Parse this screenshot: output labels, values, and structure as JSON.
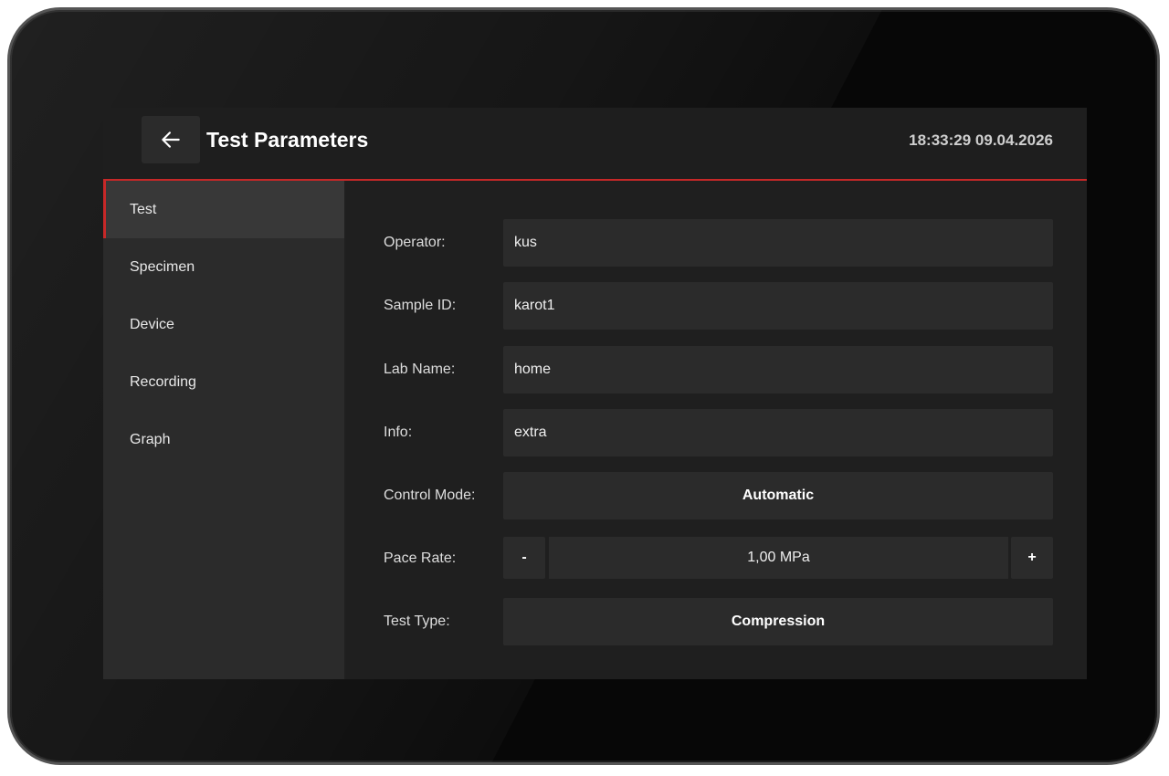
{
  "header": {
    "title": "Test Parameters",
    "datetime": "18:33:29 09.04.2026",
    "back_icon": "arrow-left-icon"
  },
  "sidebar": {
    "items": [
      {
        "label": "Test",
        "active": true
      },
      {
        "label": "Specimen",
        "active": false
      },
      {
        "label": "Device",
        "active": false
      },
      {
        "label": "Recording",
        "active": false
      },
      {
        "label": "Graph",
        "active": false
      }
    ]
  },
  "form": {
    "operator": {
      "label": "Operator:",
      "value": "kus"
    },
    "sample_id": {
      "label": "Sample ID:",
      "value": "karot1"
    },
    "lab_name": {
      "label": "Lab Name:",
      "value": "home"
    },
    "info": {
      "label": "Info:",
      "value": "extra"
    },
    "control_mode": {
      "label": "Control Mode:",
      "value": "Automatic"
    },
    "pace_rate": {
      "label": "Pace Rate:",
      "value": "1,00 MPa",
      "decrement_label": "-",
      "increment_label": "+"
    },
    "test_type": {
      "label": "Test Type:",
      "value": "Compression"
    }
  },
  "colors": {
    "accent": "#c62828",
    "background": "#1f1f1f",
    "panel": "#2b2b2b"
  }
}
